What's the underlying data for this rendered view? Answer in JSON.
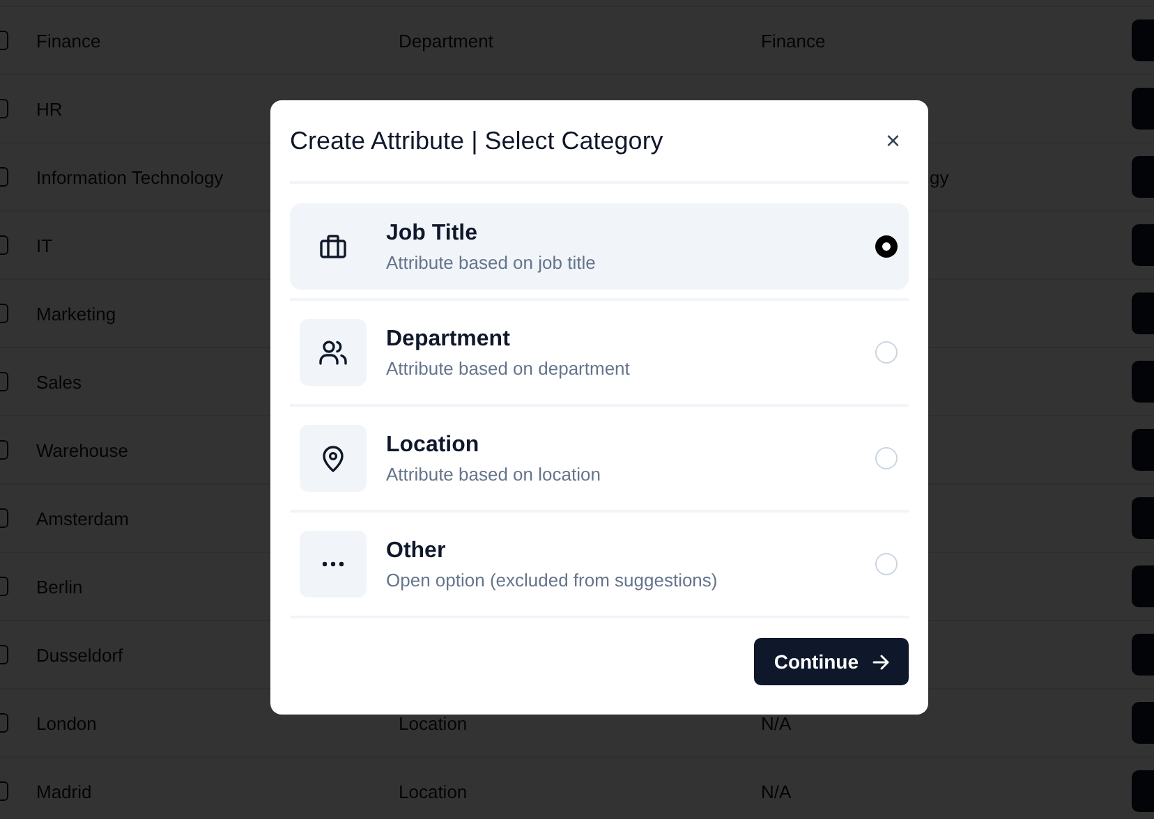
{
  "table": {
    "rows": [
      {
        "checked": false,
        "column_1": "Finance",
        "column_2": "Department",
        "column_3": "Finance"
      },
      {
        "checked": false,
        "column_1": "HR"
      },
      {
        "checked": false,
        "column_1": "Information Technology",
        "column_3": "gy",
        "column_3_partial": true
      },
      {
        "checked": false,
        "column_1": "IT"
      },
      {
        "checked": false,
        "column_1": "Marketing"
      },
      {
        "checked": false,
        "column_1": "Sales"
      },
      {
        "checked": false,
        "column_1": "Warehouse"
      },
      {
        "checked": false,
        "column_1": "Amsterdam"
      },
      {
        "checked": false,
        "column_1": "Berlin"
      },
      {
        "checked": false,
        "column_1": "Dusseldorf"
      },
      {
        "checked": false,
        "column_1": "London",
        "column_2": "Location",
        "column_3": "N/A"
      },
      {
        "checked": false,
        "column_1": "Madrid",
        "column_2": "Location",
        "column_3": "N/A"
      }
    ]
  },
  "dialog": {
    "title": "Create Attribute | Select Category",
    "close": "×",
    "options": [
      {
        "kind": "briefcase",
        "label": "Job Title",
        "description": "Attribute based on job title",
        "selected": true
      },
      {
        "kind": "people",
        "label": "Department",
        "description": "Attribute based on department",
        "selected": false
      },
      {
        "kind": "pin",
        "label": "Location",
        "description": "Attribute based on location",
        "selected": false
      },
      {
        "kind": "dots",
        "label": "Other",
        "description": "Open option (excluded from suggestions)",
        "selected": false
      }
    ],
    "continue_button": "Continue"
  }
}
